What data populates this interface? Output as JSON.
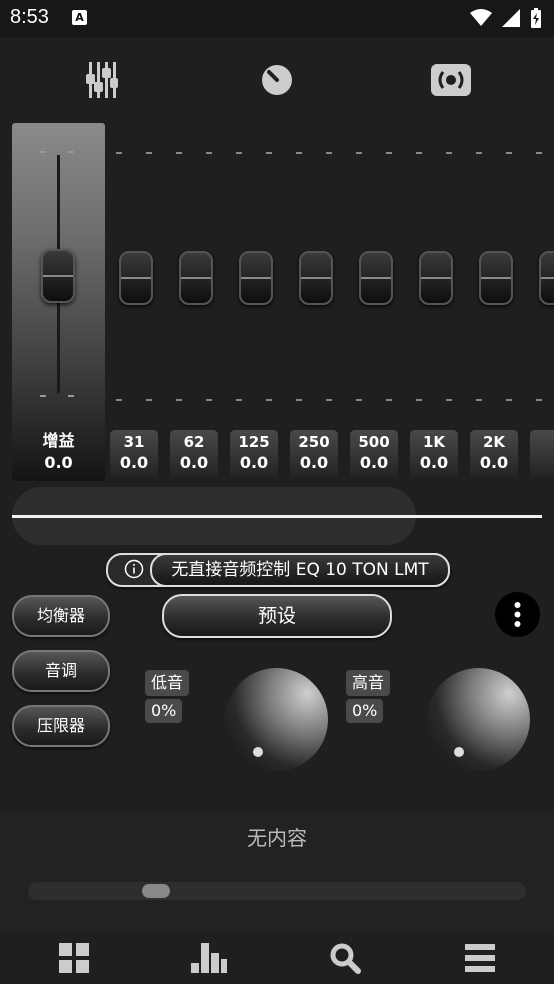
{
  "status": {
    "time": "8:53"
  },
  "gain": {
    "label": "增益",
    "value": "0.0"
  },
  "bands": [
    {
      "freq": "31",
      "value": "0.0"
    },
    {
      "freq": "62",
      "value": "0.0"
    },
    {
      "freq": "125",
      "value": "0.0"
    },
    {
      "freq": "250",
      "value": "0.0"
    },
    {
      "freq": "500",
      "value": "0.0"
    },
    {
      "freq": "1K",
      "value": "0.0"
    },
    {
      "freq": "2K",
      "value": "0.0"
    }
  ],
  "info_bar": {
    "text": "无直接音频控制 EQ 10 TON LMT"
  },
  "side_menu": {
    "equalizer": "均衡器",
    "tone": "音调",
    "limiter": "压限器"
  },
  "preset_button": "预设",
  "bass": {
    "label": "低音",
    "value": "0%"
  },
  "treble": {
    "label": "高音",
    "value": "0%"
  },
  "empty_message": "无内容",
  "colors": {
    "background": "#1f1f1f",
    "accent": "#f2f2f2"
  }
}
